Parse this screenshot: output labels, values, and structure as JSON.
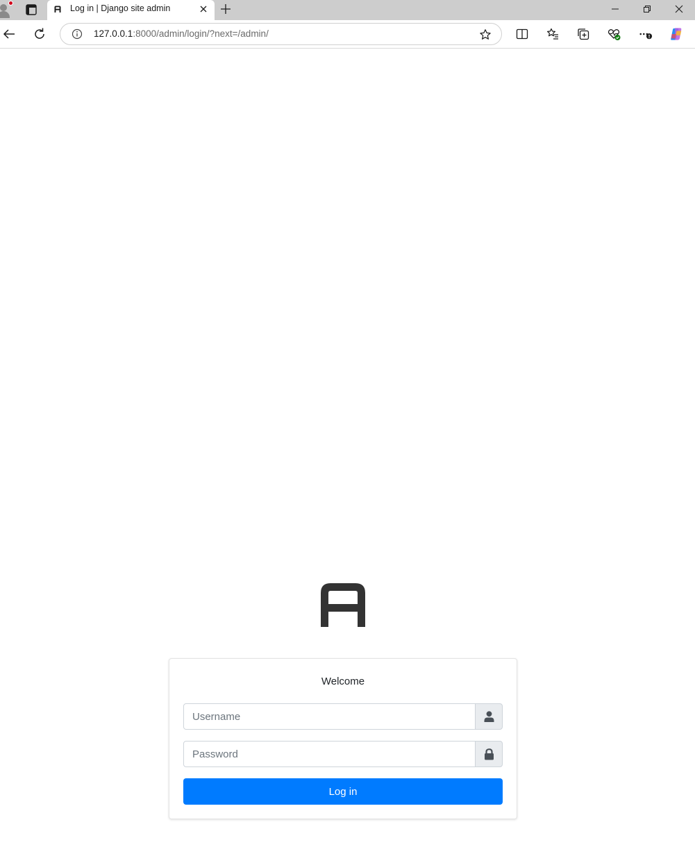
{
  "browser": {
    "tab_title": "Log in | Django site admin",
    "url_host": "127.0.0.1",
    "url_rest": ":8000/admin/login/?next=/admin/"
  },
  "login": {
    "welcome": "Welcome",
    "username_placeholder": "Username",
    "username_value": "",
    "password_placeholder": "Password",
    "password_value": "",
    "submit_label": "Log in"
  },
  "colors": {
    "primary": "#007bff",
    "logo": "#333333"
  }
}
